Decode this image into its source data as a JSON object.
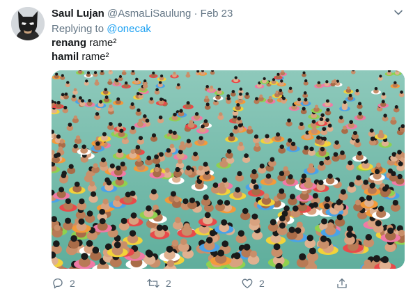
{
  "tweet": {
    "display_name": "Saul Lujan",
    "handle": "@AsmaLiSaulung",
    "separator": " · ",
    "date": "Feb 23",
    "replying_prefix": "Replying to ",
    "replying_to": "@onecak",
    "lines": [
      {
        "bold": "renang",
        "rest": " rame²"
      },
      {
        "bold": "hamil",
        "rest": " rame²"
      }
    ],
    "actions": {
      "reply_count": "2",
      "retweet_count": "2",
      "like_count": "2"
    }
  },
  "icons": {
    "caret": "chevron-down-icon",
    "reply": "reply-icon",
    "retweet": "retweet-icon",
    "like": "heart-icon",
    "share": "share-icon"
  },
  "colors": {
    "link": "#1da1f2",
    "muted": "#657786",
    "text": "#14171a",
    "pool_water": "#6fb8a6"
  }
}
